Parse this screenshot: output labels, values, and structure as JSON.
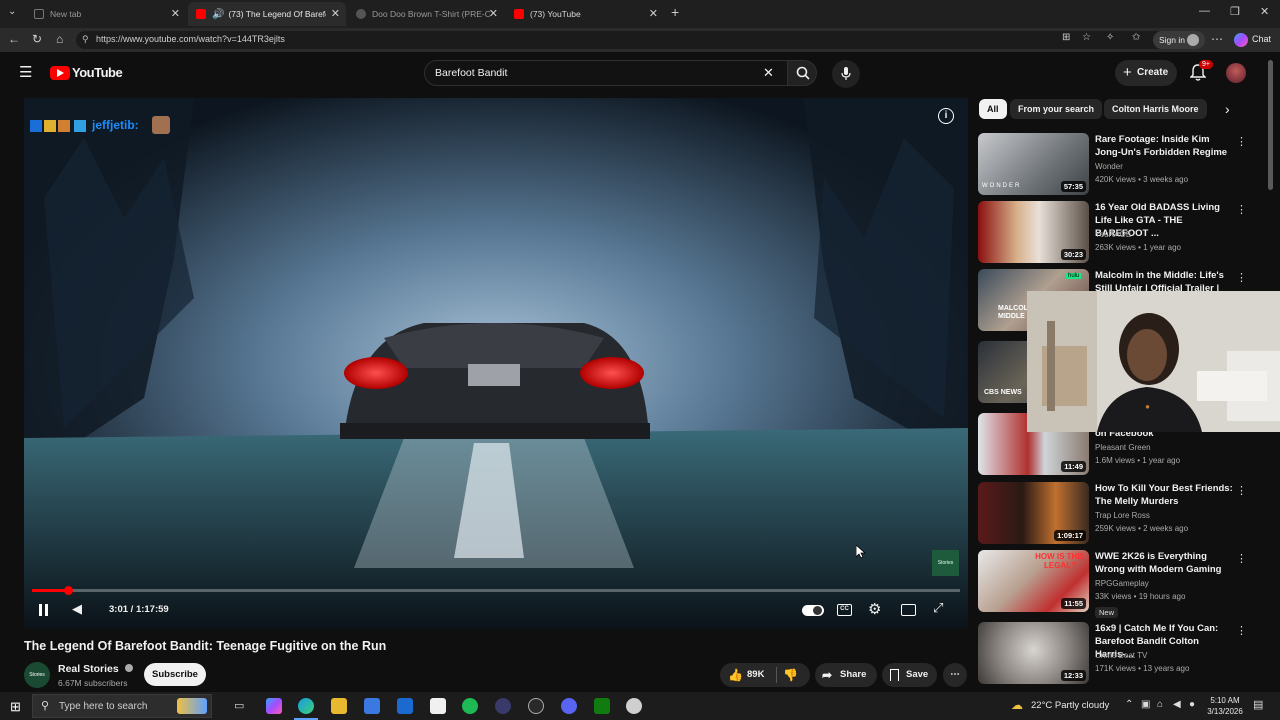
{
  "browser": {
    "tabs": [
      {
        "label": "New tab",
        "active": false
      },
      {
        "label": "(73) The Legend Of Barefoot Bandit",
        "active": true
      },
      {
        "label": "Doo Doo Brown T-Shirt (PRE-ORDER)",
        "active": false
      },
      {
        "label": "(73) YouTube",
        "active": false
      }
    ],
    "new_tab": "+",
    "url": "https://www.youtube.com/watch?v=144TR3ejlts",
    "sign_in": "Sign in",
    "chat": "Chat"
  },
  "youtube": {
    "logo": "YouTube",
    "search_value": "Barefoot Bandit",
    "create_label": "Create",
    "notif_badge": "9+"
  },
  "player": {
    "overlay_name": "jeffjetib:",
    "time_current": "3:01",
    "time_sep": "/",
    "time_total": "1:17:59",
    "progress": 0.039,
    "watermark": "Stories"
  },
  "video": {
    "title": "The Legend Of Barefoot Bandit: Teenage Fugitive on the Run",
    "channel": "Real Stories",
    "avatar_text": "Stories",
    "subscribers": "6.67M subscribers",
    "subscribe_label": "Subscribe",
    "likes": "89K",
    "share_label": "Share",
    "save_label": "Save"
  },
  "chips": [
    "All",
    "From your search",
    "Colton Harris Moore"
  ],
  "recommendations": [
    {
      "title": "Rare Footage: Inside Kim Jong-Un's Forbidden Regime",
      "channel": "Wonder",
      "meta": "420K views • 3 weeks ago",
      "duration": "57:35",
      "thumb_text": "WONDER"
    },
    {
      "title": "16 Year Old BADASS Living Life Like GTA - THE BAREFOOT ...",
      "channel": "YouRAGE",
      "meta": "263K views • 1 year ago",
      "duration": "30:23"
    },
    {
      "title": "Malcolm in the Middle: Life's Still Unfair | Official Trailer |",
      "channel": "",
      "meta": "",
      "duration": "",
      "thumb_text": "MALCOLM MIDDLE",
      "badge": "hulu"
    },
    {
      "title": "",
      "channel": "",
      "meta": "",
      "duration": "",
      "thumb_text": "CBS NEWS"
    },
    {
      "title": "on Facebook",
      "channel": "Pleasant Green",
      "meta": "1.6M views • 1 year ago",
      "duration": "11:49"
    },
    {
      "title": "How To Kill Your Best Friends: The Melly Murders",
      "channel": "Trap Lore Ross",
      "meta": "259K views • 2 weeks ago",
      "duration": "1:09:17"
    },
    {
      "title": "WWE 2K26 is Everything Wrong with Modern Gaming",
      "channel": "RPGGameplay",
      "meta": "33K views • 19 hours ago",
      "duration": "11:55",
      "badge_new": "New",
      "thumb_text": "HOW IS THIS LEGAL?"
    },
    {
      "title": "16x9 | Catch Me If You Can: Barefoot Bandit Colton Harris-...",
      "channel": "Crime Beat TV",
      "meta": "171K views • 13 years ago",
      "duration": "12:33"
    }
  ],
  "taskbar": {
    "search_placeholder": "Type here to search",
    "weather": "22°C  Partly cloudy",
    "time": "5:10 AM",
    "date": "3/13/2026"
  },
  "colors": {
    "youtube_red": "#ff0000",
    "bg": "#0f0f0f",
    "chip_bg": "#272727"
  }
}
